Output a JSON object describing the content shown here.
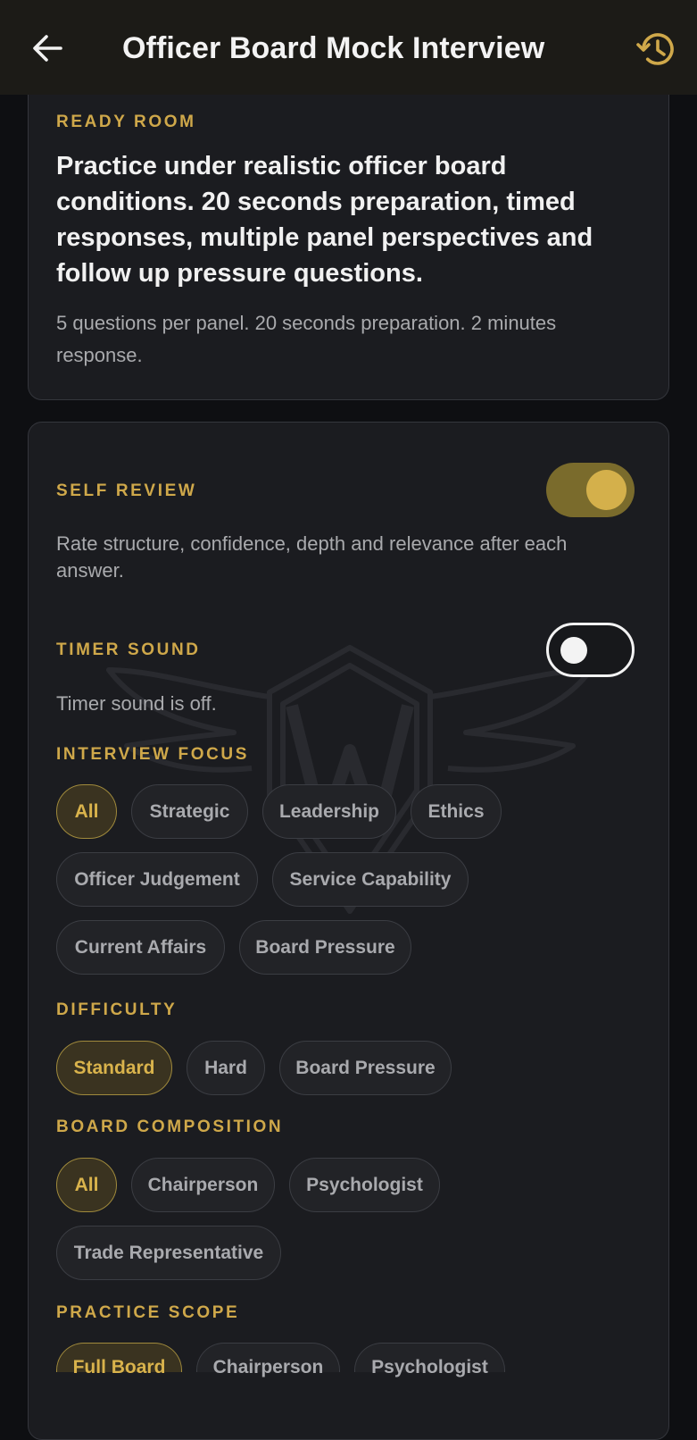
{
  "header": {
    "title": "Officer Board Mock Interview",
    "back_icon": "arrow-left-icon",
    "history_icon": "history-icon",
    "accent_color": "#cfa84a"
  },
  "ready_room": {
    "eyebrow": "READY ROOM",
    "headline": "Practice under realistic officer board conditions. 20 seconds preparation, timed responses, multiple panel perspectives and follow up pressure questions.",
    "details": "5 questions per panel. 20 seconds preparation. 2 minutes response."
  },
  "settings": {
    "self_review": {
      "label": "SELF REVIEW",
      "enabled": true,
      "description": "Rate structure, confidence, depth and relevance after each answer."
    },
    "timer_sound": {
      "label": "TIMER SOUND",
      "enabled": false,
      "description": "Timer sound is off."
    },
    "interview_focus": {
      "label": "INTERVIEW FOCUS",
      "options": [
        "All",
        "Strategic",
        "Leadership",
        "Ethics",
        "Officer Judgement",
        "Service Capability",
        "Current Affairs",
        "Board Pressure"
      ],
      "selected": "All"
    },
    "difficulty": {
      "label": "DIFFICULTY",
      "options": [
        "Standard",
        "Hard",
        "Board Pressure"
      ],
      "selected": "Standard"
    },
    "board_composition": {
      "label": "BOARD COMPOSITION",
      "options": [
        "All",
        "Chairperson",
        "Psychologist",
        "Trade Representative"
      ],
      "selected": "All"
    },
    "practice_scope": {
      "label": "PRACTICE SCOPE",
      "options": [
        "Full Board",
        "Chairperson",
        "Psychologist"
      ],
      "selected": "Full Board"
    }
  }
}
